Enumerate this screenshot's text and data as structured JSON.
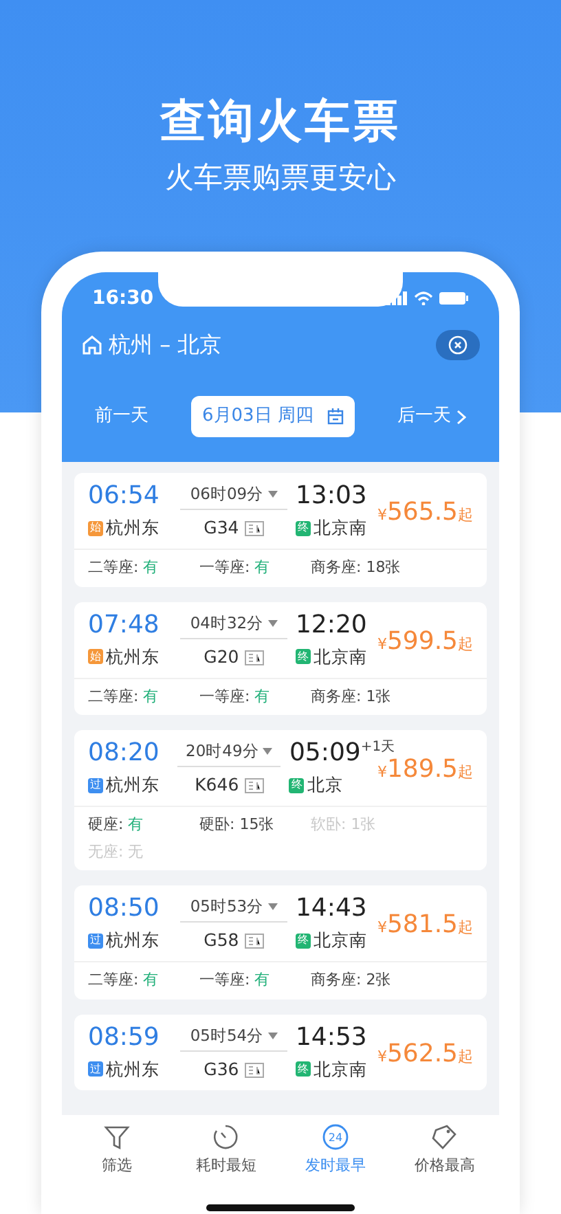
{
  "headline": "查询火车票",
  "subheadline": "火车票购票更安心",
  "status_bar": {
    "time": "16:30"
  },
  "route": {
    "title": "杭州 – 北京"
  },
  "date_bar": {
    "prev": "前一天",
    "date": "6月03日 周四",
    "next": "后一天"
  },
  "trains": [
    {
      "depart": "06:54",
      "from": {
        "badge": "始",
        "color": "#f5973a",
        "name": "杭州东"
      },
      "duration": "06时09分",
      "train_no": "G34",
      "arrive": "13:03",
      "to": {
        "badge": "终",
        "color": "#22b573",
        "name": "北京南"
      },
      "currency": "¥",
      "price": "565.5",
      "price_suffix": "起",
      "seats": [
        {
          "label": "二等座:",
          "value": "有",
          "available": true,
          "disabled": false
        },
        {
          "label": "一等座:",
          "value": "有",
          "available": true,
          "disabled": false
        },
        {
          "label": "商务座:",
          "value": "18张",
          "available": false,
          "disabled": false
        }
      ]
    },
    {
      "depart": "07:48",
      "from": {
        "badge": "始",
        "color": "#f5973a",
        "name": "杭州东"
      },
      "duration": "04时32分",
      "train_no": "G20",
      "arrive": "12:20",
      "to": {
        "badge": "终",
        "color": "#22b573",
        "name": "北京南"
      },
      "currency": "¥",
      "price": "599.5",
      "price_suffix": "起",
      "seats": [
        {
          "label": "二等座:",
          "value": "有",
          "available": true,
          "disabled": false
        },
        {
          "label": "一等座:",
          "value": "有",
          "available": true,
          "disabled": false
        },
        {
          "label": "商务座:",
          "value": "1张",
          "available": false,
          "disabled": false
        }
      ]
    },
    {
      "depart": "08:20",
      "from": {
        "badge": "过",
        "color": "#3d8ef0",
        "name": "杭州东"
      },
      "duration": "20时49分",
      "train_no": "K646",
      "arrive": "05:09",
      "day_offset": "+1天",
      "to": {
        "badge": "终",
        "color": "#22b573",
        "name": "北京"
      },
      "currency": "¥",
      "price": "189.5",
      "price_suffix": "起",
      "seats": [
        {
          "label": "硬座:",
          "value": "有",
          "available": true,
          "disabled": false
        },
        {
          "label": "硬卧:",
          "value": "15张",
          "available": false,
          "disabled": false
        },
        {
          "label": "软卧:",
          "value": "1张",
          "available": false,
          "disabled": true
        },
        {
          "label": "无座:",
          "value": "无",
          "available": false,
          "disabled": true
        }
      ]
    },
    {
      "depart": "08:50",
      "from": {
        "badge": "过",
        "color": "#3d8ef0",
        "name": "杭州东"
      },
      "duration": "05时53分",
      "train_no": "G58",
      "arrive": "14:43",
      "to": {
        "badge": "终",
        "color": "#22b573",
        "name": "北京南"
      },
      "currency": "¥",
      "price": "581.5",
      "price_suffix": "起",
      "seats": [
        {
          "label": "二等座:",
          "value": "有",
          "available": true,
          "disabled": false
        },
        {
          "label": "一等座:",
          "value": "有",
          "available": true,
          "disabled": false
        },
        {
          "label": "商务座:",
          "value": "2张",
          "available": false,
          "disabled": false
        }
      ]
    },
    {
      "depart": "08:59",
      "from": {
        "badge": "过",
        "color": "#3d8ef0",
        "name": "杭州东"
      },
      "duration": "05时54分",
      "train_no": "G36",
      "arrive": "14:53",
      "to": {
        "badge": "终",
        "color": "#22b573",
        "name": "北京南"
      },
      "currency": "¥",
      "price": "562.5",
      "price_suffix": "起"
    }
  ],
  "tabs": [
    {
      "kind": "filter",
      "label": "筛选",
      "selected": false
    },
    {
      "kind": "timer",
      "label": "耗时最短",
      "selected": false
    },
    {
      "kind": "clock24",
      "icon_text": "24",
      "label": "发时最早",
      "selected": true
    },
    {
      "kind": "tag",
      "label": "价格最高",
      "selected": false
    }
  ]
}
